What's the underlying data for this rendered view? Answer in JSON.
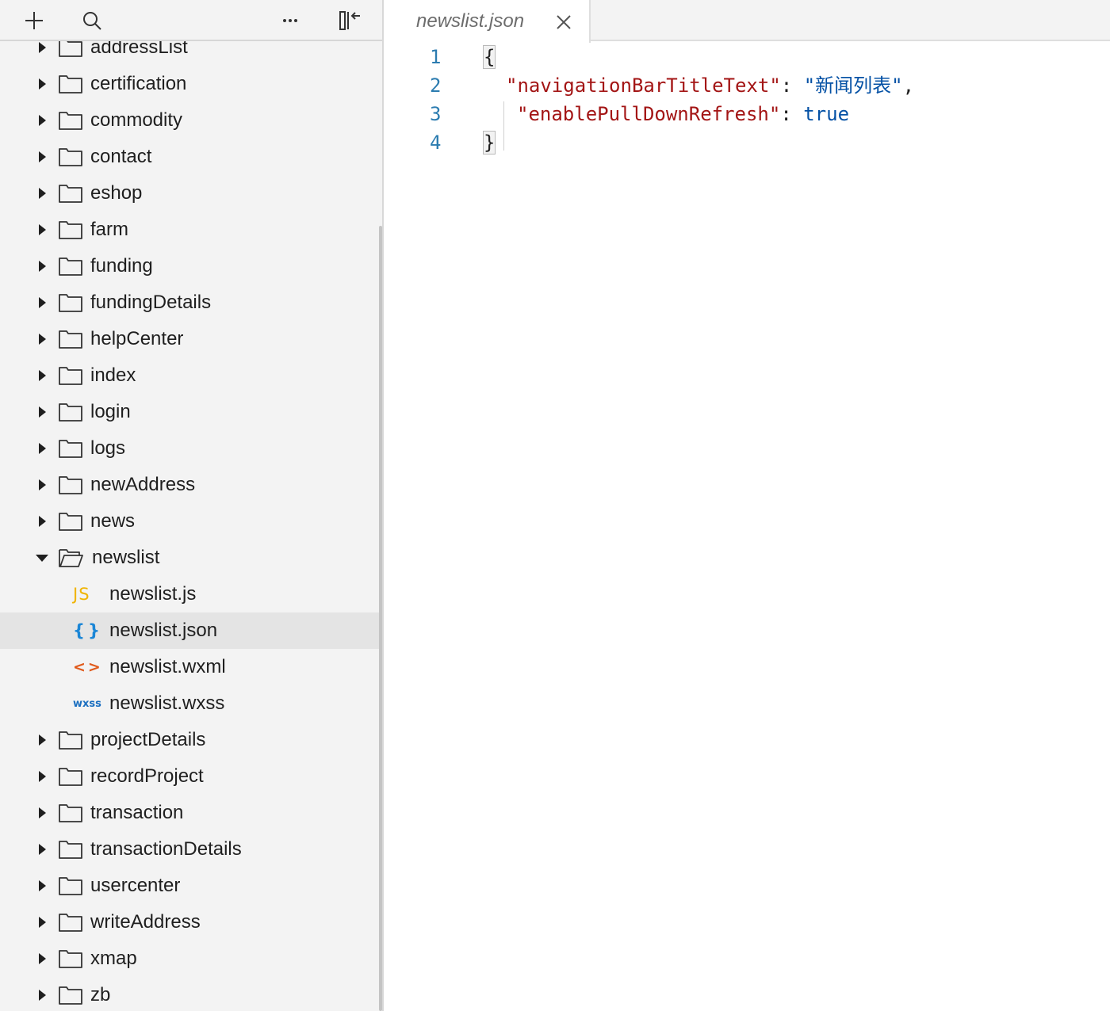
{
  "toolbar": {
    "icons": [
      "add-icon",
      "search-icon",
      "more-icon",
      "collapse-sidebar-icon"
    ]
  },
  "tree": {
    "items": [
      {
        "label": "addressList",
        "type": "folder"
      },
      {
        "label": "certification",
        "type": "folder"
      },
      {
        "label": "commodity",
        "type": "folder"
      },
      {
        "label": "contact",
        "type": "folder"
      },
      {
        "label": "eshop",
        "type": "folder"
      },
      {
        "label": "farm",
        "type": "folder"
      },
      {
        "label": "funding",
        "type": "folder"
      },
      {
        "label": "fundingDetails",
        "type": "folder"
      },
      {
        "label": "helpCenter",
        "type": "folder"
      },
      {
        "label": "index",
        "type": "folder"
      },
      {
        "label": "login",
        "type": "folder"
      },
      {
        "label": "logs",
        "type": "folder"
      },
      {
        "label": "newAddress",
        "type": "folder"
      },
      {
        "label": "news",
        "type": "folder"
      },
      {
        "label": "newslist",
        "type": "folder-open"
      },
      {
        "label": "newslist.js",
        "type": "js",
        "icon_text": "JS"
      },
      {
        "label": "newslist.json",
        "type": "json",
        "icon_text": "{}",
        "selected": true
      },
      {
        "label": "newslist.wxml",
        "type": "wxml",
        "icon_text": "<>"
      },
      {
        "label": "newslist.wxss",
        "type": "wxss",
        "icon_text": "wxss"
      },
      {
        "label": "projectDetails",
        "type": "folder"
      },
      {
        "label": "recordProject",
        "type": "folder"
      },
      {
        "label": "transaction",
        "type": "folder"
      },
      {
        "label": "transactionDetails",
        "type": "folder"
      },
      {
        "label": "usercenter",
        "type": "folder"
      },
      {
        "label": "writeAddress",
        "type": "folder"
      },
      {
        "label": "xmap",
        "type": "folder"
      },
      {
        "label": "zb",
        "type": "folder"
      }
    ]
  },
  "editor": {
    "tab_title": "newslist.json",
    "line_numbers": [
      "1",
      "2",
      "3",
      "4"
    ],
    "code": {
      "open_brace": "{",
      "key1": "\"navigationBarTitleText\"",
      "colon": ":",
      "value1": "\"新闻列表\"",
      "comma": ",",
      "key2": "\"enablePullDownRefresh\"",
      "value2": "true",
      "close_brace": "}"
    }
  },
  "colors": {
    "sidebar_bg": "#f3f3f3",
    "selected_row": "#e4e4e4",
    "json_key": "#a31515",
    "json_value": "#0451a5",
    "line_number": "#2c7cb0",
    "js_icon": "#f0b400",
    "json_icon": "#1b86d6",
    "wxml_icon": "#e05a1b",
    "wxss_icon": "#1b6fc0"
  }
}
